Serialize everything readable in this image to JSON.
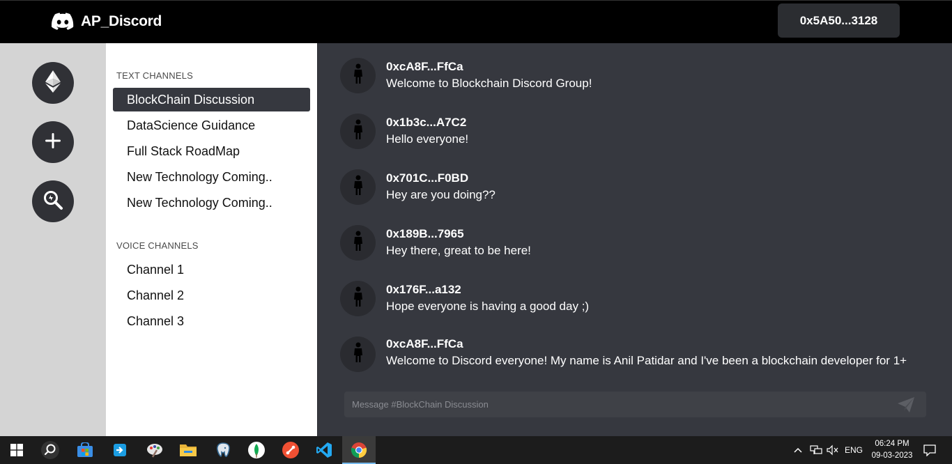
{
  "app": {
    "title": "AP_Discord",
    "account": "0x5A50...3128",
    "logo_icon": "discord-icon"
  },
  "servers": [
    {
      "icon": "ethereum-icon"
    },
    {
      "icon": "plus-icon"
    },
    {
      "icon": "explore-icon"
    }
  ],
  "channels": {
    "text_label": "TEXT CHANNELS",
    "text": [
      {
        "name": "BlockChain Discussion",
        "active": true
      },
      {
        "name": "DataScience Guidance"
      },
      {
        "name": "Full Stack RoadMap"
      },
      {
        "name": "New Technology Coming.."
      },
      {
        "name": "New Technology Coming.."
      }
    ],
    "voice_label": "VOICE CHANNELS",
    "voice": [
      {
        "name": "Channel 1"
      },
      {
        "name": "Channel 2"
      },
      {
        "name": "Channel 3"
      }
    ]
  },
  "messages": [
    {
      "author": "0xcA8F...FfCa",
      "text": "Welcome to Blockchain Discord Group!"
    },
    {
      "author": "0x1b3c...A7C2",
      "text": "Hello everyone!"
    },
    {
      "author": "0x701C...F0BD",
      "text": "Hey are you doing??"
    },
    {
      "author": "0x189B...7965",
      "text": "Hey there, great to be here!"
    },
    {
      "author": "0x176F...a132",
      "text": "Hope everyone is having a good day ;)"
    },
    {
      "author": "0xcA8F...FfCa",
      "text": "Welcome to Discord everyone! My name is Anil Patidar and I've been a blockchain developer for 1+"
    }
  ],
  "composer": {
    "placeholder": "Message #BlockChain Discussion",
    "send_icon": "send-icon"
  },
  "taskbar": {
    "apps": [
      "windows-start-icon",
      "search-icon",
      "store-icon",
      "outlook-icon",
      "paint-icon",
      "file-explorer-icon",
      "postgresql-icon",
      "mongodb-icon",
      "git-icon",
      "vscode-icon",
      "chrome-icon"
    ],
    "language": "ENG",
    "time": "06:24 PM",
    "date": "09-03-2023"
  }
}
